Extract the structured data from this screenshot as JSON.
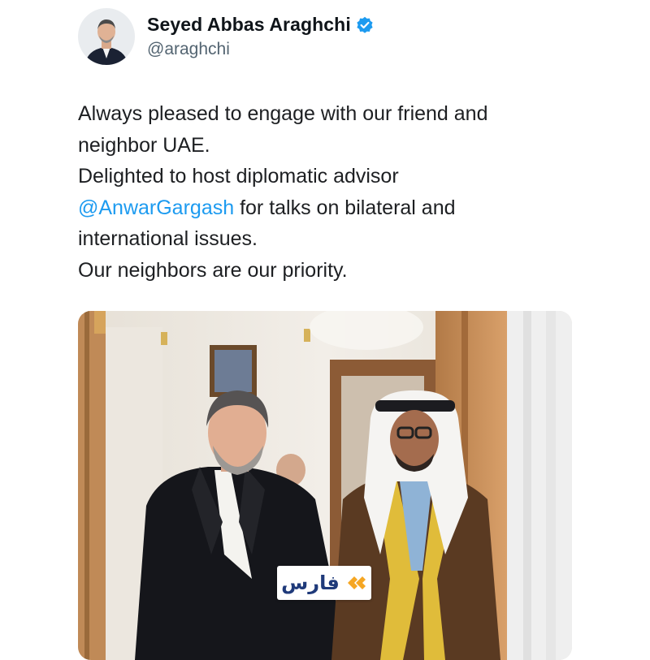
{
  "author": {
    "display_name": "Seyed Abbas Araghchi",
    "handle": "@araghchi",
    "verified": true,
    "verified_color": "#1d9bf0"
  },
  "tweet": {
    "line1": "Always pleased to engage with our friend and",
    "line2": "neighbor UAE.",
    "line3": "Delighted to host diplomatic advisor",
    "mention": "@AnwarGargash",
    "line4_rest": " for talks on bilateral and",
    "line5": "international issues.",
    "line6": "Our neighbors are our priority.",
    "mention_color": "#1d9bf0"
  },
  "media": {
    "watermark_text": "فارس",
    "watermark_logo_colors": [
      "#f5a623",
      "#1f3a7a"
    ]
  }
}
